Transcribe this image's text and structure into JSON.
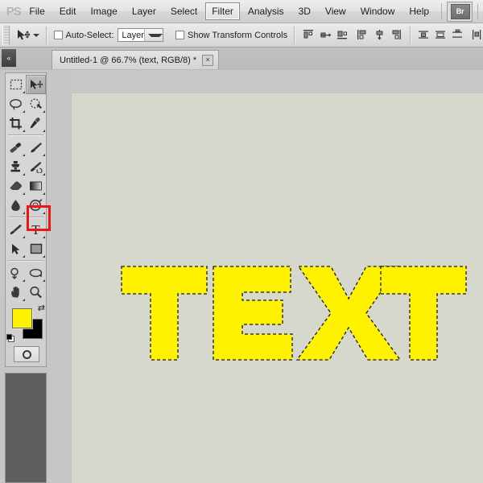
{
  "app": {
    "name": "PS",
    "logo_label": "PS"
  },
  "menubar": {
    "items": [
      {
        "label": "File",
        "active": false
      },
      {
        "label": "Edit",
        "active": false
      },
      {
        "label": "Image",
        "active": false
      },
      {
        "label": "Layer",
        "active": false
      },
      {
        "label": "Select",
        "active": false
      },
      {
        "label": "Filter",
        "active": true
      },
      {
        "label": "Analysis",
        "active": false
      },
      {
        "label": "3D",
        "active": false
      },
      {
        "label": "View",
        "active": false
      },
      {
        "label": "Window",
        "active": false
      },
      {
        "label": "Help",
        "active": false
      }
    ],
    "bridge_button": "Br"
  },
  "optionsbar": {
    "tool_icon": "move-tool-icon",
    "auto_select_label": "Auto-Select:",
    "auto_select_checked": false,
    "layer_select_value": "Layer",
    "show_transform_label": "Show Transform Controls",
    "show_transform_checked": false,
    "align_buttons": [
      "align-left-edges-icon",
      "align-horizontal-centers-icon",
      "align-right-edges-icon",
      "align-top-edges-icon",
      "align-vertical-centers-icon",
      "align-bottom-edges-icon",
      "distribute-top-edges-icon",
      "distribute-vertical-centers-icon",
      "distribute-bottom-edges-icon",
      "distribute-left-edges-icon"
    ]
  },
  "document": {
    "tab_title": "Untitled-1 @ 66.7% (text, RGB/8) *",
    "close_label": "×",
    "dock_collapse_label": "«",
    "zoom": "66.7%",
    "color_mode": "RGB/8",
    "layer_name": "text",
    "modified": true
  },
  "toolbar": {
    "tools": [
      {
        "name": "rectangular-marquee-tool",
        "active": false,
        "has_flyout": true
      },
      {
        "name": "move-tool",
        "active": true,
        "has_flyout": false
      },
      {
        "name": "lasso-tool",
        "active": false,
        "has_flyout": true
      },
      {
        "name": "quick-selection-tool",
        "active": false,
        "has_flyout": true
      },
      {
        "name": "crop-tool",
        "active": false,
        "has_flyout": true
      },
      {
        "name": "eyedropper-tool",
        "active": false,
        "has_flyout": true
      },
      {
        "name": "spot-healing-brush-tool",
        "active": false,
        "has_flyout": true
      },
      {
        "name": "brush-tool",
        "active": false,
        "has_flyout": true
      },
      {
        "name": "clone-stamp-tool",
        "active": false,
        "has_flyout": true
      },
      {
        "name": "history-brush-tool",
        "active": false,
        "has_flyout": true
      },
      {
        "name": "eraser-tool",
        "active": false,
        "has_flyout": true
      },
      {
        "name": "gradient-tool",
        "active": false,
        "has_flyout": true
      },
      {
        "name": "blur-tool",
        "active": false,
        "has_flyout": true
      },
      {
        "name": "dodge-tool",
        "active": false,
        "has_flyout": true
      },
      {
        "name": "pen-tool",
        "active": false,
        "has_flyout": true
      },
      {
        "name": "horizontal-type-tool",
        "active": false,
        "has_flyout": true,
        "label": "T",
        "highlighted": true
      },
      {
        "name": "path-selection-tool",
        "active": false,
        "has_flyout": true
      },
      {
        "name": "rectangle-tool",
        "active": false,
        "has_flyout": true
      },
      {
        "name": "rotate-view-tool",
        "active": false,
        "has_flyout": true
      },
      {
        "name": "three-d-orbit-tool",
        "active": false,
        "has_flyout": true
      },
      {
        "name": "hand-tool",
        "active": false,
        "has_flyout": true
      },
      {
        "name": "zoom-tool",
        "active": false,
        "has_flyout": false
      }
    ],
    "foreground_color": "#FFF200",
    "background_color": "#000000",
    "swap_colors_label": "⇄",
    "quick_mask_label": "quick-mask-icon"
  },
  "canvas": {
    "background_color": "#D7D8CD",
    "artwork_text": "TEXT",
    "artwork_fill": "#FFF200",
    "selection_active": true,
    "selection_style": "marching-ants"
  },
  "highlight": {
    "color": "#F01414",
    "target": "horizontal-type-tool"
  }
}
